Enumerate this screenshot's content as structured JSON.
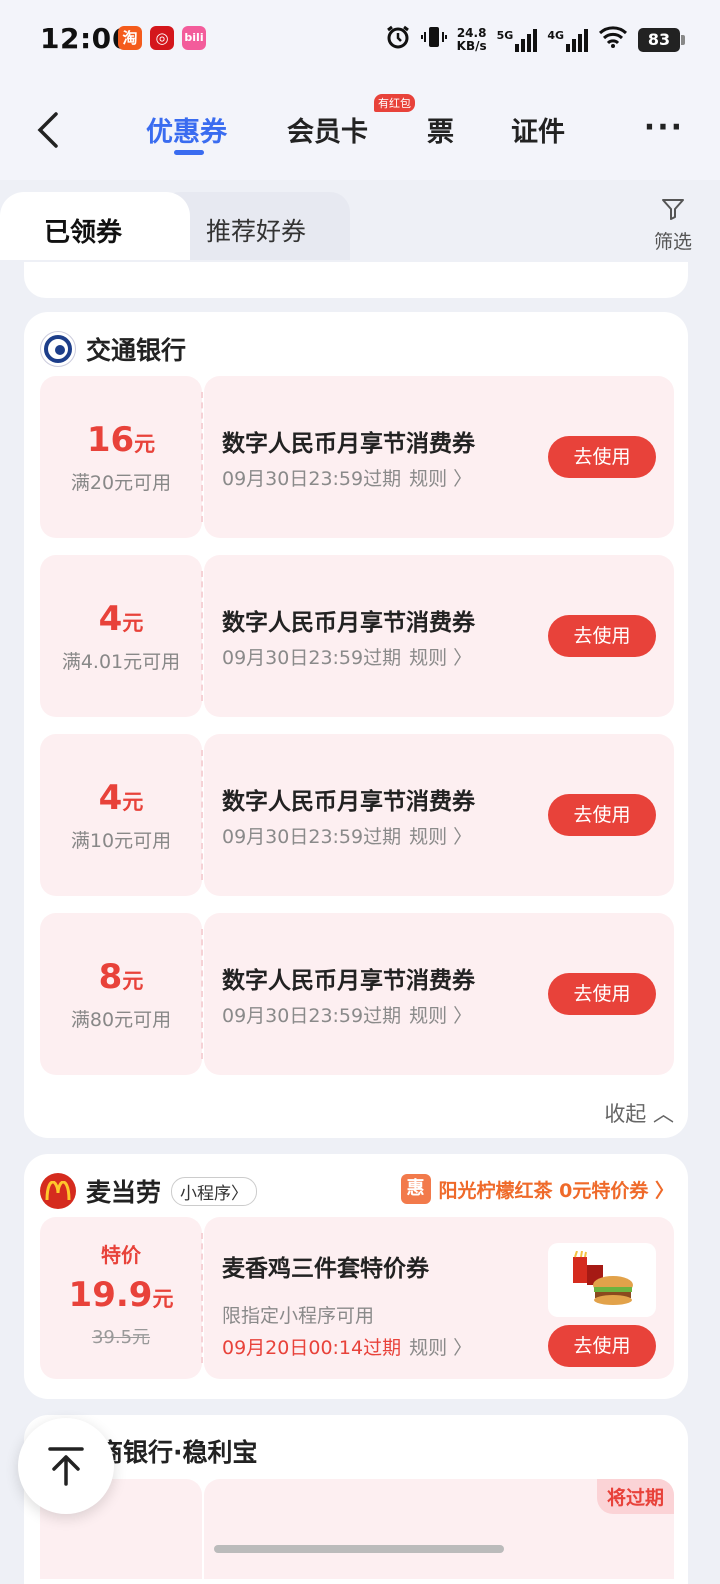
{
  "status_bar": {
    "time": "12:06",
    "net_speed_value": "24.8",
    "net_speed_unit": "KB/s",
    "sig1": "5G",
    "sig2": "4G",
    "battery": "83"
  },
  "header": {
    "tabs": [
      "优惠券",
      "会员卡",
      "票",
      "证件"
    ],
    "hongbao_badge": "有红包",
    "more": "···"
  },
  "subtabs": {
    "active": "已领券",
    "other": "推荐好券",
    "filter": "筛选"
  },
  "bank_card": {
    "name": "交通银行",
    "coupons": [
      {
        "amount": "16",
        "unit": "元",
        "condition": "满20元可用",
        "title": "数字人民币月享节消费券",
        "expire": "09月30日23:59过期",
        "rule": "规则 〉",
        "button": "去使用"
      },
      {
        "amount": "4",
        "unit": "元",
        "condition": "满4.01元可用",
        "title": "数字人民币月享节消费券",
        "expire": "09月30日23:59过期",
        "rule": "规则 〉",
        "button": "去使用"
      },
      {
        "amount": "4",
        "unit": "元",
        "condition": "满10元可用",
        "title": "数字人民币月享节消费券",
        "expire": "09月30日23:59过期",
        "rule": "规则 〉",
        "button": "去使用"
      },
      {
        "amount": "8",
        "unit": "元",
        "condition": "满80元可用",
        "title": "数字人民币月享节消费券",
        "expire": "09月30日23:59过期",
        "rule": "规则 〉",
        "button": "去使用"
      }
    ],
    "collapse": "收起 ︿"
  },
  "mcd_card": {
    "name": "麦当劳",
    "tag": "小程序〉",
    "promo_badge": "惠",
    "promo_text": "阳光柠檬红茶 0元特价券 〉",
    "coupon": {
      "label": "特价",
      "price": "19.9",
      "unit": "元",
      "original": "39.5元",
      "title": "麦香鸡三件套特价券",
      "desc": "限指定小程序可用",
      "expire": "09月20日00:14过期",
      "rule": "规则 〉",
      "button": "去使用"
    }
  },
  "icbc_card": {
    "name": "商银行·稳利宝",
    "expiring": "将过期"
  },
  "colors": {
    "accent": "#3a6cf0",
    "red": "#e8423a",
    "coupon_bg": "#fdeff1"
  }
}
